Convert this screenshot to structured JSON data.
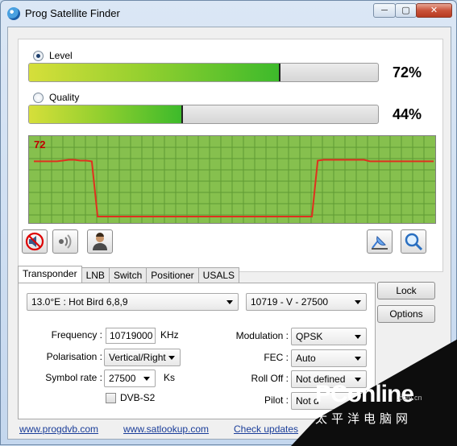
{
  "window": {
    "title": "Prog Satellite Finder",
    "min_glyph": "─",
    "max_glyph": "▢",
    "close_glyph": "✕"
  },
  "meters": {
    "level_label": "Level",
    "level_value": 72,
    "level_text": "72%",
    "level_selected": true,
    "quality_label": "Quality",
    "quality_value": 44,
    "quality_text": "44%",
    "quality_selected": false
  },
  "chart_data": {
    "type": "line",
    "title": "",
    "label": "72",
    "ylim": [
      0,
      100
    ],
    "series": [
      {
        "values": [
          72,
          72,
          72,
          72,
          72,
          73,
          74,
          74,
          73,
          73,
          72,
          2,
          2,
          2,
          2,
          2,
          2,
          2,
          2,
          2,
          2,
          2,
          2,
          2,
          2,
          2,
          2,
          2,
          2,
          2,
          2,
          2,
          2,
          2,
          2,
          2,
          2,
          2,
          2,
          2,
          2,
          2,
          2,
          2,
          2,
          2,
          2,
          2,
          2,
          73,
          74,
          74,
          74,
          74,
          74,
          74,
          74,
          74,
          72,
          72,
          72,
          72,
          72,
          72,
          72,
          72,
          72,
          72,
          72,
          72
        ]
      }
    ],
    "colors": {
      "background": "#86c04e",
      "grid": "#5f9a34",
      "line": "#e0301e"
    }
  },
  "tool_icons": [
    "mute-speaker-icon",
    "signal-sound-icon",
    "user-icon",
    "satellite-dish-icon",
    "magnifier-icon"
  ],
  "tabs": [
    "Transponder",
    "LNB",
    "Switch",
    "Positioner",
    "USALS"
  ],
  "transponder": {
    "satellite": "13.0°E : Hot Bird 6,8,9",
    "transponder": "10719 - V - 27500",
    "frequency_label": "Frequency :",
    "frequency_value": "10719000",
    "frequency_unit": "KHz",
    "polarisation_label": "Polarisation :",
    "polarisation_value": "Vertical/Right",
    "symbol_rate_label": "Symbol rate :",
    "symbol_rate_value": "27500",
    "symbol_rate_unit": "Ks",
    "dvbs2_label": "DVB-S2",
    "modulation_label": "Modulation :",
    "modulation_value": "QPSK",
    "fec_label": "FEC :",
    "fec_value": "Auto",
    "rolloff_label": "Roll Off :",
    "rolloff_value": "Not defined",
    "pilot_label": "Pilot :",
    "pilot_value": "Not d"
  },
  "buttons": {
    "lock": "Lock",
    "options": "Options"
  },
  "links": [
    "www.progdvb.com",
    "www.satlookup.com",
    "Check updates"
  ],
  "watermark": {
    "brand": "PConline",
    "domain": ".com.cn",
    "chinese": "太平洋电脑网"
  }
}
